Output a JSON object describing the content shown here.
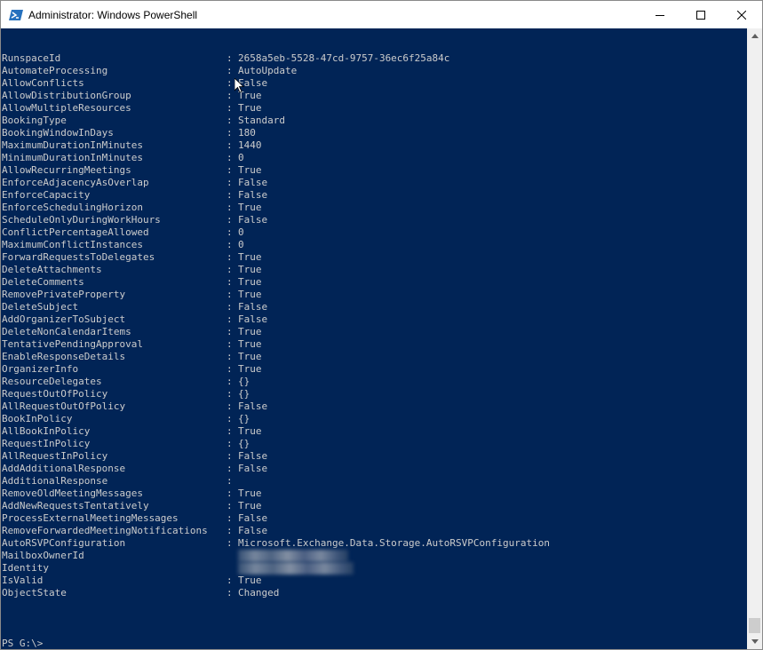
{
  "window": {
    "title": "Administrator: Windows PowerShell",
    "colors": {
      "console_background": "#012456",
      "console_text": "#cccccc",
      "titlebar_background": "#ffffff"
    }
  },
  "titlebar": {
    "app_icon": "powershell-icon",
    "buttons": [
      "minimize-icon",
      "maximize-icon",
      "close-icon"
    ]
  },
  "output": [
    {
      "name": "RunspaceId",
      "value": "2658a5eb-5528-47cd-9757-36ec6f25a84c"
    },
    {
      "name": "AutomateProcessing",
      "value": "AutoUpdate"
    },
    {
      "name": "AllowConflicts",
      "value": "False"
    },
    {
      "name": "AllowDistributionGroup",
      "value": "True"
    },
    {
      "name": "AllowMultipleResources",
      "value": "True"
    },
    {
      "name": "BookingType",
      "value": "Standard"
    },
    {
      "name": "BookingWindowInDays",
      "value": "180"
    },
    {
      "name": "MaximumDurationInMinutes",
      "value": "1440"
    },
    {
      "name": "MinimumDurationInMinutes",
      "value": "0"
    },
    {
      "name": "AllowRecurringMeetings",
      "value": "True"
    },
    {
      "name": "EnforceAdjacencyAsOverlap",
      "value": "False"
    },
    {
      "name": "EnforceCapacity",
      "value": "False"
    },
    {
      "name": "EnforceSchedulingHorizon",
      "value": "True"
    },
    {
      "name": "ScheduleOnlyDuringWorkHours",
      "value": "False"
    },
    {
      "name": "ConflictPercentageAllowed",
      "value": "0"
    },
    {
      "name": "MaximumConflictInstances",
      "value": "0"
    },
    {
      "name": "ForwardRequestsToDelegates",
      "value": "True"
    },
    {
      "name": "DeleteAttachments",
      "value": "True"
    },
    {
      "name": "DeleteComments",
      "value": "True"
    },
    {
      "name": "RemovePrivateProperty",
      "value": "True"
    },
    {
      "name": "DeleteSubject",
      "value": "False"
    },
    {
      "name": "AddOrganizerToSubject",
      "value": "False"
    },
    {
      "name": "DeleteNonCalendarItems",
      "value": "True"
    },
    {
      "name": "TentativePendingApproval",
      "value": "True"
    },
    {
      "name": "EnableResponseDetails",
      "value": "True"
    },
    {
      "name": "OrganizerInfo",
      "value": "True"
    },
    {
      "name": "ResourceDelegates",
      "value": "{}"
    },
    {
      "name": "RequestOutOfPolicy",
      "value": "{}"
    },
    {
      "name": "AllRequestOutOfPolicy",
      "value": "False"
    },
    {
      "name": "BookInPolicy",
      "value": "{}"
    },
    {
      "name": "AllBookInPolicy",
      "value": "True"
    },
    {
      "name": "RequestInPolicy",
      "value": "{}"
    },
    {
      "name": "AllRequestInPolicy",
      "value": "False"
    },
    {
      "name": "AddAdditionalResponse",
      "value": "False"
    },
    {
      "name": "AdditionalResponse",
      "value": ""
    },
    {
      "name": "RemoveOldMeetingMessages",
      "value": "True"
    },
    {
      "name": "AddNewRequestsTentatively",
      "value": "True"
    },
    {
      "name": "ProcessExternalMeetingMessages",
      "value": "False"
    },
    {
      "name": "RemoveForwardedMeetingNotifications",
      "value": "False"
    },
    {
      "name": "AutoRSVPConfiguration",
      "value": "Microsoft.Exchange.Data.Storage.AutoRSVPConfiguration"
    },
    {
      "name": "MailboxOwnerId",
      "value": "",
      "redacted": true
    },
    {
      "name": "Identity",
      "value": "",
      "redacted": true
    },
    {
      "name": "IsValid",
      "value": "True"
    },
    {
      "name": "ObjectState",
      "value": "Changed"
    }
  ],
  "separator": ":",
  "prompt": "PS G:\\>"
}
